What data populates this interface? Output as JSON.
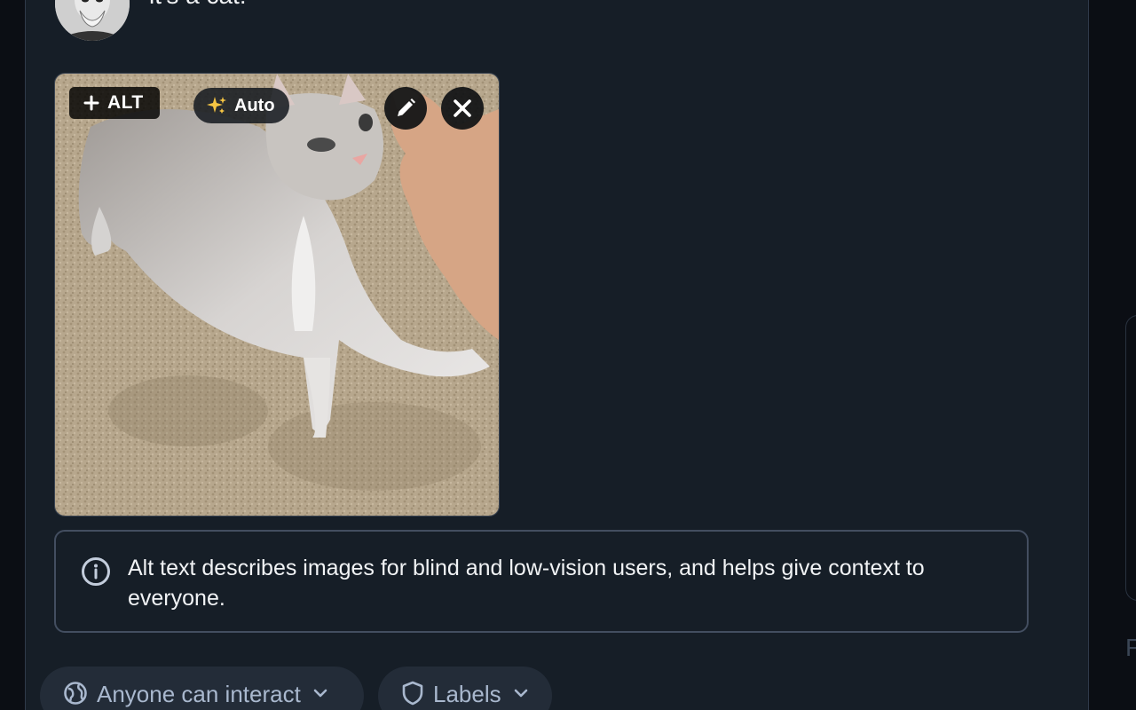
{
  "post": {
    "text": "it's a cat!",
    "avatar_icon": "user-avatar"
  },
  "media": {
    "alt_button_label": "ALT",
    "auto_button_label": "Auto",
    "edit_icon": "pencil-icon",
    "remove_icon": "close-icon"
  },
  "alt_info": {
    "text": "Alt text describes images for blind and low-vision users, and helps give context to everyone."
  },
  "controls": {
    "interaction_label": "Anyone can interact",
    "labels_label": "Labels"
  },
  "side_panel": {
    "partial_letter": "F"
  },
  "colors": {
    "panel": "#161e27",
    "pill_bg": "#232c38",
    "pill_text": "#a9b8ce",
    "border": "#434e60"
  }
}
